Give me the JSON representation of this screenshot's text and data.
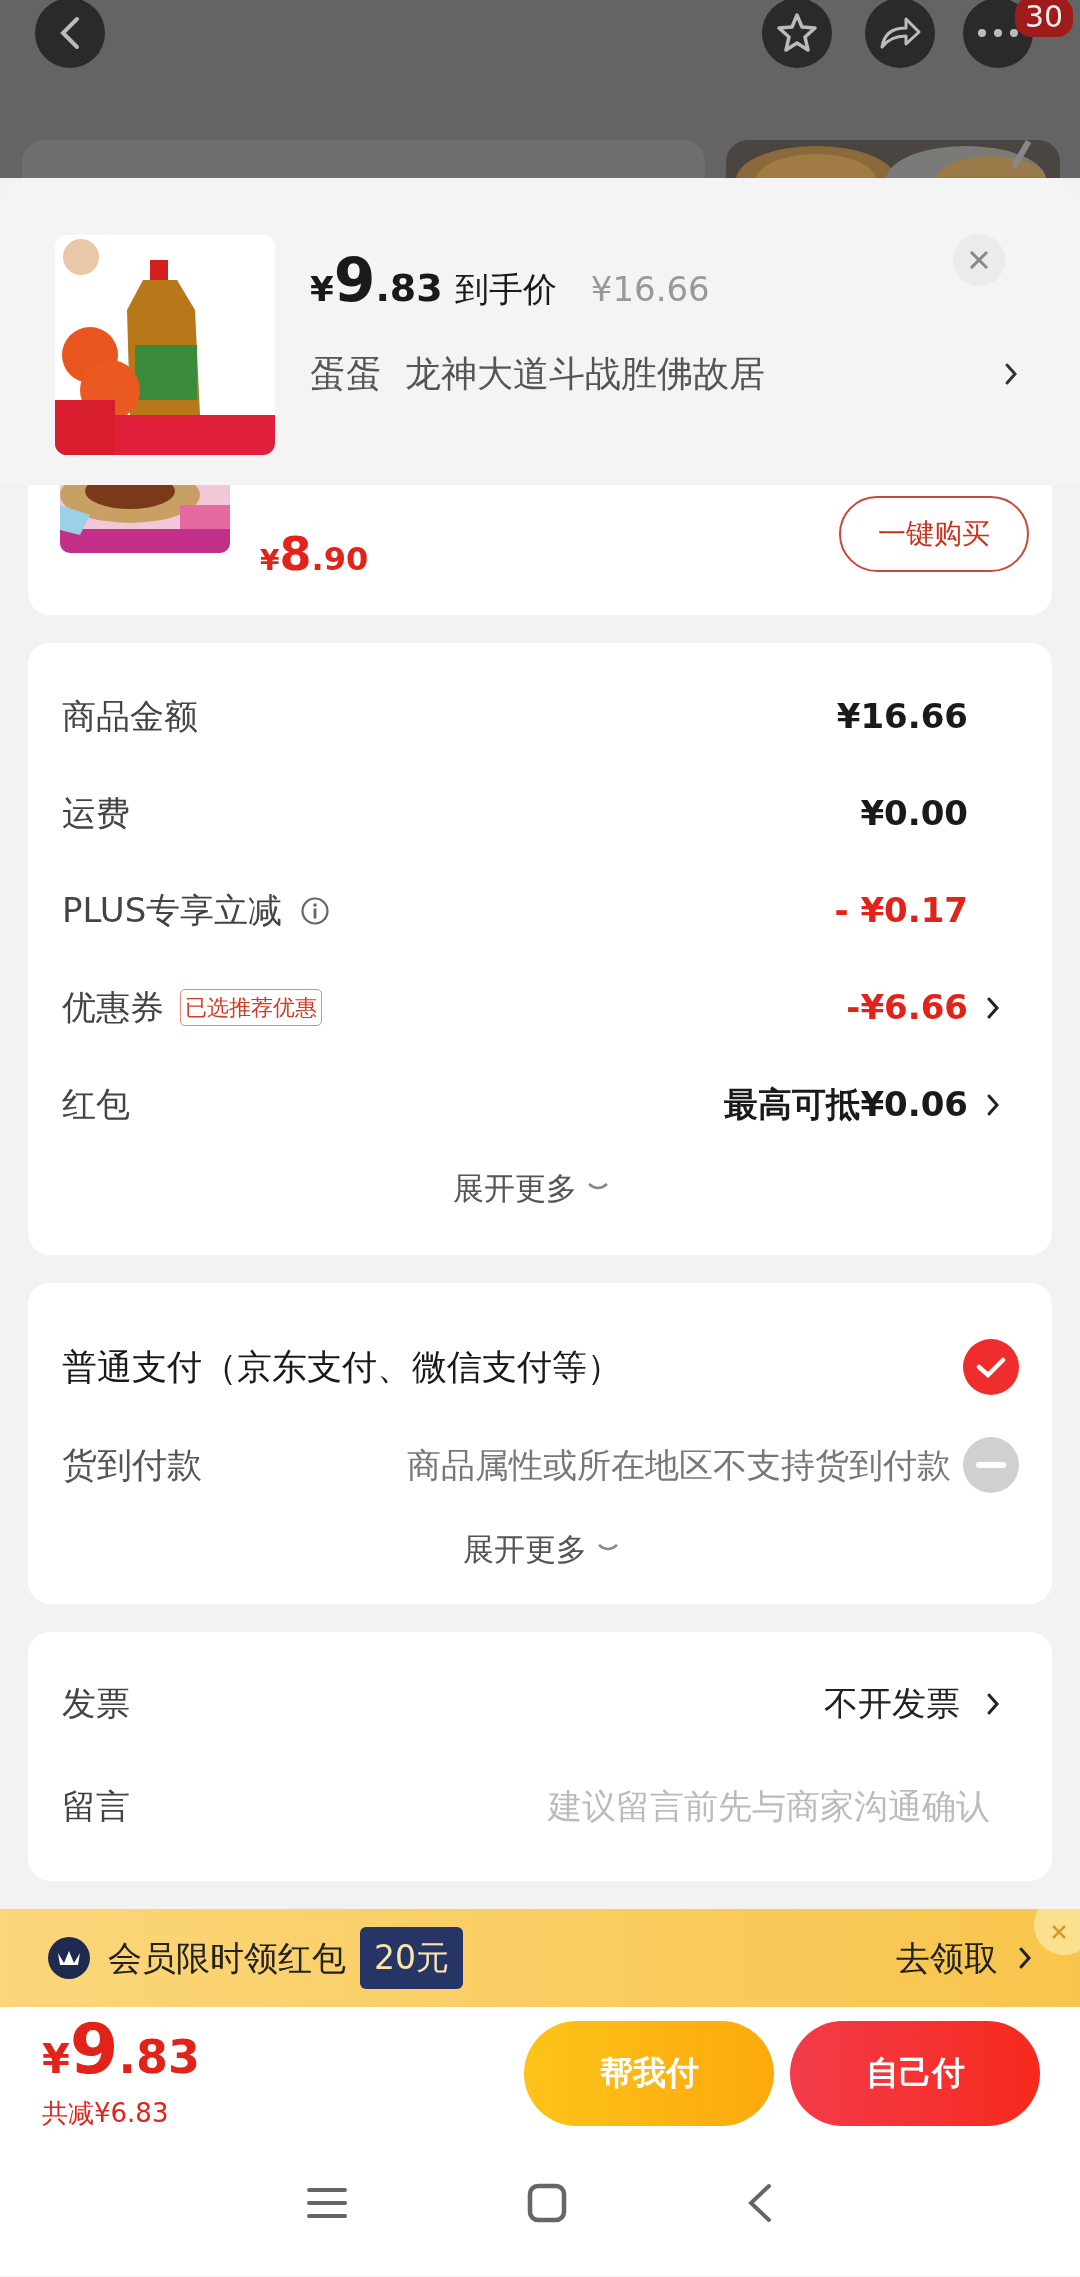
{
  "top_bar": {
    "badge": "30"
  },
  "product": {
    "price": {
      "currency": "¥",
      "integer": "9",
      "decimal": ".83"
    },
    "price_label": "到手价",
    "original_price": "¥16.66",
    "store": "蛋蛋  龙神大道斗战胜佛故居"
  },
  "related_item": {
    "price": {
      "currency": "¥",
      "integer": "8",
      "decimal": ".90"
    },
    "button": "一键购买"
  },
  "summary": {
    "rows": [
      {
        "label": "商品金额",
        "value": "¥16.66",
        "highlight": false,
        "info": false,
        "chevron": false
      },
      {
        "label": "运费",
        "value": "¥0.00",
        "highlight": false,
        "info": false,
        "chevron": false
      },
      {
        "label": "PLUS专享立减",
        "value": "- ¥0.17",
        "highlight": true,
        "info": true,
        "chevron": false
      },
      {
        "label": "优惠券",
        "tag": "已选推荐优惠",
        "value": "-¥6.66",
        "highlight": true,
        "info": false,
        "chevron": true
      },
      {
        "label": "红包",
        "value": "最高可抵¥0.06",
        "highlight": false,
        "info": false,
        "chevron": true
      }
    ],
    "expand": "展开更多"
  },
  "payment": {
    "options": [
      {
        "label": "普通支付（京东支付、微信支付等）",
        "selected": true,
        "disabled": false
      },
      {
        "label": "货到付款",
        "note": "商品属性或所在地区不支持货到付款",
        "selected": false,
        "disabled": true
      }
    ],
    "expand": "展开更多"
  },
  "invoice": {
    "label": "发票",
    "value": "不开发票"
  },
  "message": {
    "label": "留言",
    "placeholder": "建议留言前先与商家沟通确认"
  },
  "banner": {
    "text": "会员限时领红包",
    "amount": "20元",
    "action": "去领取"
  },
  "footer": {
    "price": {
      "currency": "¥",
      "integer": "9",
      "decimal": ".83"
    },
    "saving": "共减¥6.83",
    "buttons": [
      {
        "label": "帮我付",
        "kind": "friend"
      },
      {
        "label": "自己付",
        "kind": "self"
      }
    ]
  }
}
